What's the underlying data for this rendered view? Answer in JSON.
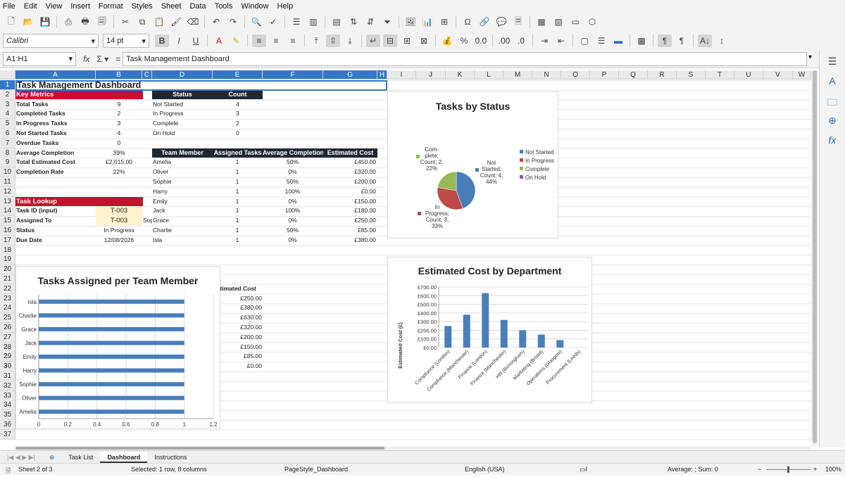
{
  "menu": [
    "File",
    "Edit",
    "View",
    "Insert",
    "Format",
    "Styles",
    "Sheet",
    "Data",
    "Tools",
    "Window",
    "Help"
  ],
  "font": {
    "name": "Calibri",
    "size": "14 pt"
  },
  "namebox": "A1:H1",
  "formula": "Task Management Dashboard",
  "columns": [
    "A",
    "B",
    "C",
    "D",
    "E",
    "F",
    "G",
    "H",
    "I",
    "J",
    "K",
    "L",
    "M",
    "N",
    "O",
    "P",
    "Q",
    "R",
    "S",
    "T",
    "U",
    "V",
    "W"
  ],
  "rows": [
    "1",
    "2",
    "3",
    "4",
    "5",
    "6",
    "7",
    "8",
    "9",
    "10",
    "11",
    "12",
    "13",
    "14",
    "15",
    "16",
    "17",
    "18",
    "19",
    "20",
    "21",
    "22",
    "23",
    "24",
    "25",
    "26",
    "27",
    "28",
    "29",
    "30",
    "31",
    "32",
    "33",
    "34",
    "35",
    "36",
    "37"
  ],
  "title": "Task Management Dashboard",
  "key_metrics": {
    "header": "Key Metrics",
    "items": [
      {
        "label": "Total Tasks",
        "value": "9"
      },
      {
        "label": "Completed Tasks",
        "value": "2"
      },
      {
        "label": "In Progress Tasks",
        "value": "3"
      },
      {
        "label": "Not Started Tasks",
        "value": "4"
      },
      {
        "label": "Overdue Tasks",
        "value": "0"
      },
      {
        "label": "Average Completion",
        "value": "39%"
      },
      {
        "label": "Total Estimated Cost",
        "value": "£2,015.00"
      },
      {
        "label": "Completion Rate",
        "value": "22%"
      }
    ]
  },
  "status_table": {
    "headers": [
      "Status",
      "Count"
    ],
    "rows": [
      [
        "Not Started",
        "4"
      ],
      [
        "In Progress",
        "3"
      ],
      [
        "Complete",
        "2"
      ],
      [
        "On Hold",
        "0"
      ]
    ]
  },
  "team_table": {
    "headers": [
      "Team Member",
      "Assigned Tasks",
      "Average Completion",
      "Estimated Cost"
    ],
    "rows": [
      [
        "Amelia",
        "1",
        "50%",
        "£450.00"
      ],
      [
        "Oliver",
        "1",
        "0%",
        "£320.00"
      ],
      [
        "Sophie",
        "1",
        "50%",
        "£200.00"
      ],
      [
        "Harry",
        "1",
        "100%",
        "£0.00"
      ],
      [
        "Emily",
        "1",
        "0%",
        "£150.00"
      ],
      [
        "Jack",
        "1",
        "100%",
        "£180.00"
      ],
      [
        "Grace",
        "1",
        "0%",
        "£250.00"
      ],
      [
        "Charlie",
        "1",
        "50%",
        "£85.00"
      ],
      [
        "Isla",
        "1",
        "0%",
        "£380.00"
      ]
    ]
  },
  "lookup": {
    "header": "Task Lookup",
    "items": [
      {
        "label": "Task ID (input)",
        "value": "T-003"
      },
      {
        "label": "Assigned To",
        "value": "T-003"
      },
      {
        "label": "Status",
        "value": "In Progress"
      },
      {
        "label": "Due Date",
        "value": "12/08/2026"
      }
    ],
    "overflow": "Sop"
  },
  "hidden_cost": {
    "header": "Estimated Cost",
    "values": [
      "£250.00",
      "£380.00",
      "£630.00",
      "£320.00",
      "£200.00",
      "£150.00",
      "£85.00",
      "£0.00"
    ]
  },
  "chart_data": [
    {
      "type": "pie",
      "title": "Tasks by Status",
      "categories": [
        "Not Started",
        "In Progress",
        "Complete",
        "On Hold"
      ],
      "values": [
        4,
        3,
        2,
        0
      ],
      "colors": [
        "#4a7ebb",
        "#be4b48",
        "#98b954",
        "#7d60a0"
      ],
      "data_labels": [
        "Not Started; Count; 4; 44%",
        "In Progress; Count; 3; 33%",
        "Com- plete; Count; 2; 22%"
      ],
      "legend": "right"
    },
    {
      "type": "bar",
      "orientation": "horizontal",
      "title": "Tasks Assigned per Team Member",
      "categories": [
        "Isla",
        "Charlie",
        "Grace",
        "Jack",
        "Emily",
        "Harry",
        "Sophie",
        "Oliver",
        "Amelia"
      ],
      "values": [
        1,
        1,
        1,
        1,
        1,
        1,
        1,
        1,
        1
      ],
      "xlim": [
        0,
        1.2
      ],
      "xticks": [
        "0",
        "0.2",
        "0.4",
        "0.6",
        "0.8",
        "1",
        "1.2"
      ],
      "color": "#4a7ebb",
      "grid": true
    },
    {
      "type": "bar",
      "title": "Estimated Cost by Department",
      "ylabel": "Estimated Cost (£)",
      "categories": [
        "Compliance (London)",
        "Compliance (Manchester)",
        "Finance (London)",
        "Finance (Manchester)",
        "HR (Birmingham)",
        "Marketing (Bristol)",
        "Operations (Glasgow)",
        "Procurement (Leeds)"
      ],
      "values": [
        250,
        380,
        630,
        320,
        200,
        150,
        85,
        0
      ],
      "ylim": [
        0,
        700
      ],
      "yticks": [
        "£0.00",
        "£100.00",
        "£200.00",
        "£300.00",
        "£400.00",
        "£500.00",
        "£600.00",
        "£700.00"
      ],
      "color": "#4a7ebb",
      "grid": true
    }
  ],
  "sheet_tabs": [
    "Task List",
    "Dashboard",
    "Instructions"
  ],
  "status_bar": {
    "sheet": "Sheet 2 of 3",
    "selection": "Selected: 1 row, 8 columns",
    "page_style": "PageStyle_Dashboard",
    "language": "English (USA)",
    "sum": "Average: ; Sum: 0",
    "zoom": "100%"
  }
}
